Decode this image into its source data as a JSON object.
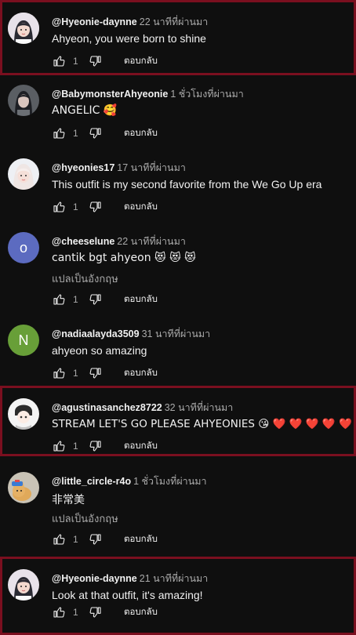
{
  "accent_color": "#7a0f1f",
  "reply_label": "ตอบกลับ",
  "translate_label": "แปลเป็นอังกฤษ",
  "comments": [
    {
      "author": "@Hyeonie-daynne",
      "time": "22 นาทีที่ผ่านมา",
      "text": "Ahyeon, you were born to shine",
      "likes": "1",
      "highlighted": true,
      "avatar_icon": "girl-avatar-icon"
    },
    {
      "author": "@BabymonsterAhyeonie",
      "time": "1 ชั่วโมงที่ผ่านมา",
      "text": "ANGELIC 🥰",
      "likes": "1",
      "highlighted": false,
      "avatar_icon": "photo-avatar-icon"
    },
    {
      "author": "@hyeonies17",
      "time": "17 นาทีที่ผ่านมา",
      "text": "This outfit is my second favorite from the We Go Up era",
      "likes": "1",
      "highlighted": false,
      "avatar_icon": "photo-avatar-icon"
    },
    {
      "author": "@cheeselune",
      "time": "22 นาทีที่ผ่านมา",
      "text": "cantik bgt ahyeon 😻 😻 😻",
      "likes": "1",
      "highlighted": false,
      "avatar_letter": "o",
      "avatar_color": "#5c6bc0",
      "translate": true
    },
    {
      "author": "@nadiaalayda3509",
      "time": "31 นาทีที่ผ่านมา",
      "text": "ahyeon so amazing",
      "likes": "1",
      "highlighted": false,
      "avatar_letter": "N",
      "avatar_color": "#689f38"
    },
    {
      "author": "@agustinasanchez8722",
      "time": "32 นาทีที่ผ่านมา",
      "text": "STREAM LET'S GO PLEASE AHYEONIES 😘 ❤️ ❤️ ❤️ ❤️ ❤️",
      "likes": "1",
      "highlighted": true,
      "avatar_icon": "anime-avatar-icon"
    },
    {
      "author": "@little_circle-r4o",
      "time": "1 ชั่วโมงที่ผ่านมา",
      "text": "非常美",
      "likes": "1",
      "highlighted": false,
      "avatar_icon": "cat-avatar-icon",
      "translate": true
    },
    {
      "author": "@Hyeonie-daynne",
      "time": "21 นาทีที่ผ่านมา",
      "text": "Look at that outfit, it's amazing!",
      "likes": "1",
      "highlighted": true,
      "avatar_icon": "girl-avatar-icon"
    }
  ]
}
